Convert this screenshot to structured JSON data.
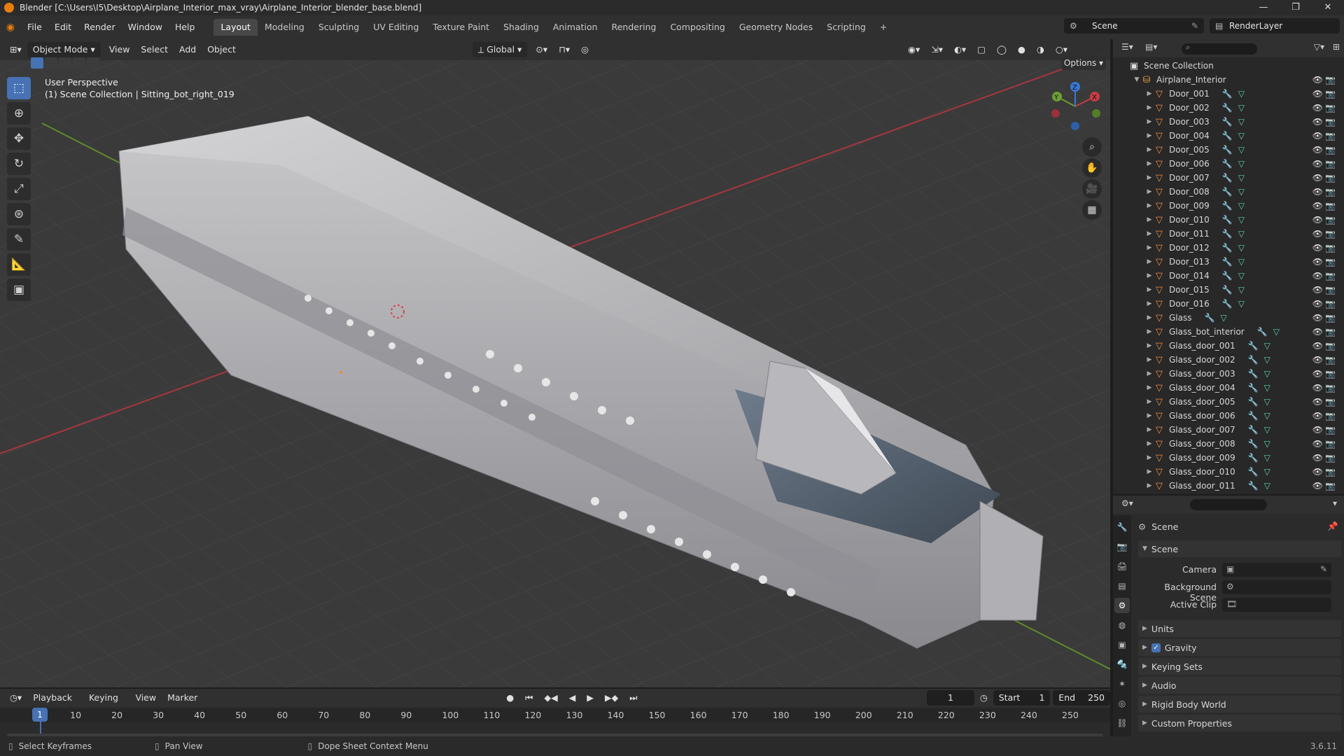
{
  "window": {
    "title": "Blender [C:\\Users\\I5\\Desktop\\Airplane_Interior_max_vray\\Airplane_Interior_blender_base.blend]",
    "controls": [
      "—",
      "❐",
      "✕"
    ]
  },
  "menubar": {
    "items": [
      "File",
      "Edit",
      "Render",
      "Window",
      "Help"
    ],
    "workspaces": [
      "Layout",
      "Modeling",
      "Sculpting",
      "UV Editing",
      "Texture Paint",
      "Shading",
      "Animation",
      "Rendering",
      "Compositing",
      "Geometry Nodes",
      "Scripting"
    ],
    "active_workspace": "Layout",
    "add_tab": "+",
    "scene": "Scene",
    "render_layer": "RenderLayer"
  },
  "viewport_header": {
    "mode": "Object Mode",
    "menus": [
      "View",
      "Select",
      "Add",
      "Object"
    ],
    "transform": "Global",
    "options": "Options"
  },
  "viewport": {
    "perspective": "User Perspective",
    "context": "(1) Scene Collection | Sitting_bot_right_019",
    "gizmo_axes": [
      "X",
      "Y",
      "Z"
    ],
    "colors": {
      "axis_x": "#c83c44",
      "axis_y": "#6ba032",
      "axis_z": "#3a78d6",
      "grid_bg": "#3a3a3a"
    }
  },
  "toolbar": {
    "tools": [
      "select-box-icon",
      "cursor-icon",
      "move-icon",
      "rotate-icon",
      "scale-icon",
      "transform-icon",
      "annotate-icon",
      "measure-icon",
      "add-cube-icon"
    ]
  },
  "outliner": {
    "root": "Scene Collection",
    "collection": "Airplane_Interior",
    "items": [
      "Door_001",
      "Door_002",
      "Door_003",
      "Door_004",
      "Door_005",
      "Door_006",
      "Door_007",
      "Door_008",
      "Door_009",
      "Door_010",
      "Door_011",
      "Door_012",
      "Door_013",
      "Door_014",
      "Door_015",
      "Door_016",
      "Glass",
      "Glass_bot_interior",
      "Glass_door_001",
      "Glass_door_002",
      "Glass_door_003",
      "Glass_door_004",
      "Glass_door_005",
      "Glass_door_006",
      "Glass_door_007",
      "Glass_door_008",
      "Glass_door_009",
      "Glass_door_010",
      "Glass_door_011"
    ]
  },
  "properties": {
    "breadcrumb": "Scene",
    "panel": "Scene",
    "fields": {
      "camera_label": "Camera",
      "background_label": "Background Scene",
      "clip_label": "Active Clip"
    },
    "subpanels": [
      "Units",
      "Gravity",
      "Keying Sets",
      "Audio",
      "Rigid Body World",
      "Custom Properties"
    ],
    "gravity_checked": true
  },
  "timeline": {
    "menus": [
      "Playback",
      "Keying",
      "View",
      "Marker"
    ],
    "current_frame": "1",
    "start_label": "Start",
    "start": "1",
    "end_label": "End",
    "end": "250",
    "ticks": [
      "1",
      "10",
      "20",
      "30",
      "40",
      "50",
      "60",
      "70",
      "80",
      "90",
      "100",
      "110",
      "120",
      "130",
      "140",
      "150",
      "160",
      "170",
      "180",
      "190",
      "200",
      "210",
      "220",
      "230",
      "240",
      "250"
    ]
  },
  "statusbar": {
    "left": "Select Keyframes",
    "middle": "Pan View",
    "right": "Dope Sheet Context Menu",
    "version": "3.6.11"
  }
}
